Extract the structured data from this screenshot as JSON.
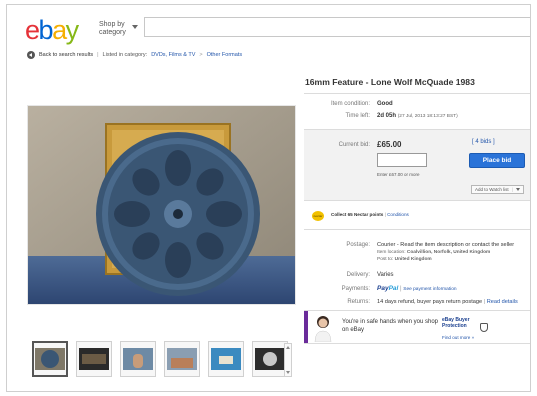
{
  "header": {
    "logo": [
      "e",
      "b",
      "a",
      "y"
    ],
    "logo_colors": [
      "#e53238",
      "#0064d2",
      "#f5af02",
      "#86b817"
    ],
    "shop_by_line1": "Shop by",
    "shop_by_line2": "category"
  },
  "breadcrumb": {
    "back": "Back to search results",
    "listed_in": "Listed in category:",
    "category1": "DVDs, Films & TV",
    "separator": ">",
    "category2": "Other Formats"
  },
  "listing": {
    "title": "16mm Feature - Lone Wolf McQuade 1983",
    "item_condition_label": "Item condition:",
    "item_condition_value": "Good",
    "time_left_label": "Time left:",
    "time_left_value": "2d 05h",
    "time_left_detail": "(27 Jul, 2013  18:13:27 BST)",
    "current_bid_label": "Current bid:",
    "current_bid_value": "£65.00",
    "bids": "[ 4 bids ]",
    "bid_note": "Enter £67.00 or more",
    "place_bid": "Place bid",
    "watch_list": "Add to Watch list",
    "points_badge": "nectar",
    "points_text": "Collect 65 Nectar points",
    "points_link": "Conditions",
    "postage_label": "Postage:",
    "postage_value": "Courier - Read the item description or contact the seller",
    "item_location_label": "Item location:",
    "item_location_value": "Coalvillion, Norfolk, United Kingdom",
    "post_to_label": "Post to:",
    "post_to_value": "United Kingdom",
    "delivery_label": "Delivery:",
    "delivery_value": "Varies",
    "payments_label": "Payments:",
    "paypal_1": "Pay",
    "paypal_2": "Pal",
    "payments_link": "See payment information",
    "returns_label": "Returns:",
    "returns_value": "14 days refund, buyer pays return postage",
    "returns_link": "Read details"
  },
  "protection": {
    "text": "You're in safe hands when you shop on eBay",
    "title": "eBay Buyer Protection",
    "link": "Find out more »"
  },
  "thumbnails": [
    {
      "name": "film-reel"
    },
    {
      "name": "film-frame-1"
    },
    {
      "name": "film-frame-2"
    },
    {
      "name": "film-frame-3"
    },
    {
      "name": "film-frame-4"
    },
    {
      "name": "film-frame-5"
    }
  ]
}
